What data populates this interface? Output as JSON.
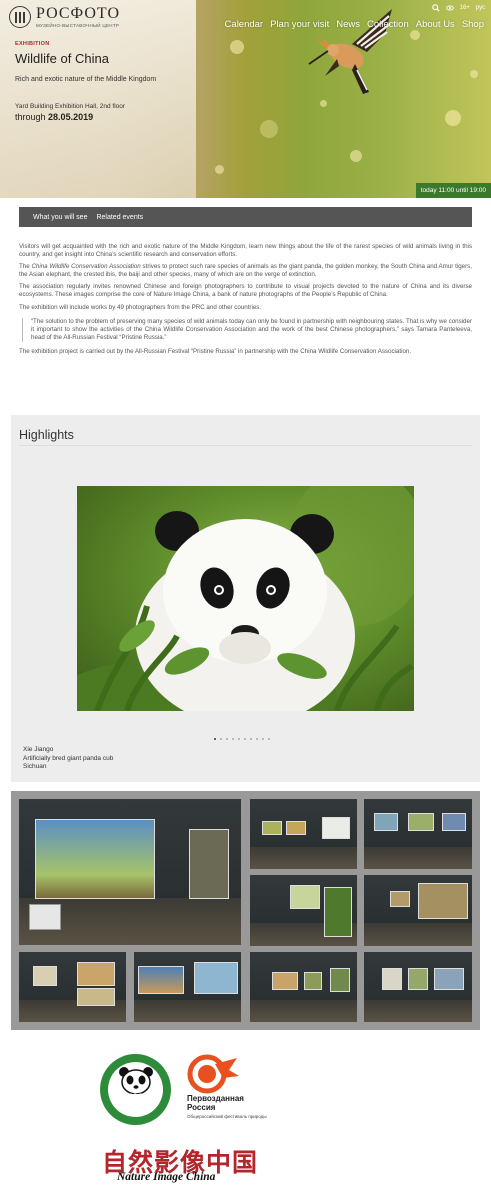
{
  "brand": {
    "name": "РОСФОТО",
    "subtitle": "МУЗЕЙНО-ВЫСТАВОЧНЫЙ ЦЕНТР"
  },
  "utility": {
    "age_rating": "16+",
    "language": "рус",
    "search_icon": "search-icon",
    "accessibility_icon": "eye-icon"
  },
  "nav": {
    "items": [
      "Calendar",
      "Plan your visit",
      "News",
      "Collection",
      "About Us",
      "Shop"
    ]
  },
  "hero": {
    "kicker": "EXHIBITION",
    "title": "Wildlife of China",
    "subtitle": "Rich and exotic nature of the Middle Kingdom",
    "venue": "Yard Building Exhibition Hall, 2nd floor",
    "through_label": "through",
    "end_date": "28.05.2019",
    "today": "today 11:00 until 19:00"
  },
  "tabs": [
    "What you will see",
    "Related events"
  ],
  "article": {
    "p1": "Visitors will get acquainted with the rich and exotic nature of the Middle Kingdom, learn new things about the life of the rarest species of wild animals living in this country, and get insight into China’s scientific research and conservation efforts.",
    "p2_org": "China Wildlife Conservation Association",
    "p2_pre": "The ",
    "p2_post": " strives to protect such rare species of animals as the giant panda, the golden monkey, the South China and Amur tigers, the Asian elephant, the crested ibis, the baiji and other species, many of which are on the verge of extinction.",
    "p3": "The association regularly invites renowned Chinese and foreign photographers to contribute to visual projects devoted to the nature of China and its diverse ecosystems. These images comprise the core of Nature Image China, a bank of nature photographs of the People’s Republic of China.",
    "p4": "The exhibition will include works by 49 photographers from the PRC and other countries.",
    "quote": "“The solution to the problem of preserving many species of wild animals today can only be found in partnership with neighbouring states. That is why we consider it important to show the activities of the China Wildlife Conservation Association and the work of the best Chinese photographers,” says Tamara Panteleeva, head of the All-Russian Festival “Pristine Russia.”",
    "p5": "The exhibition project is carried out by the All-Russian Festival “Pristine Russia” in partnership with the China Wildlife Conservation Association."
  },
  "highlights": {
    "heading": "Highlights",
    "slide_count": 10,
    "active_slide": 1,
    "caption": {
      "author": "Xie Jiango",
      "title": "Artificially bred giant panda cub",
      "place": "Sichuan"
    }
  },
  "partners": {
    "cwca": "CWCA",
    "pristine_russia_title_1": "Первозданная",
    "pristine_russia_title_2": "Россия",
    "pristine_russia_sub": "Общероссийский фестиваль природы",
    "nic_cn": "自然影像中国",
    "nic_en": "Nature Image China"
  },
  "colors": {
    "accent_red": "#b3262b",
    "today_green": "#3b7a2c",
    "tab_bar": "#555555"
  }
}
